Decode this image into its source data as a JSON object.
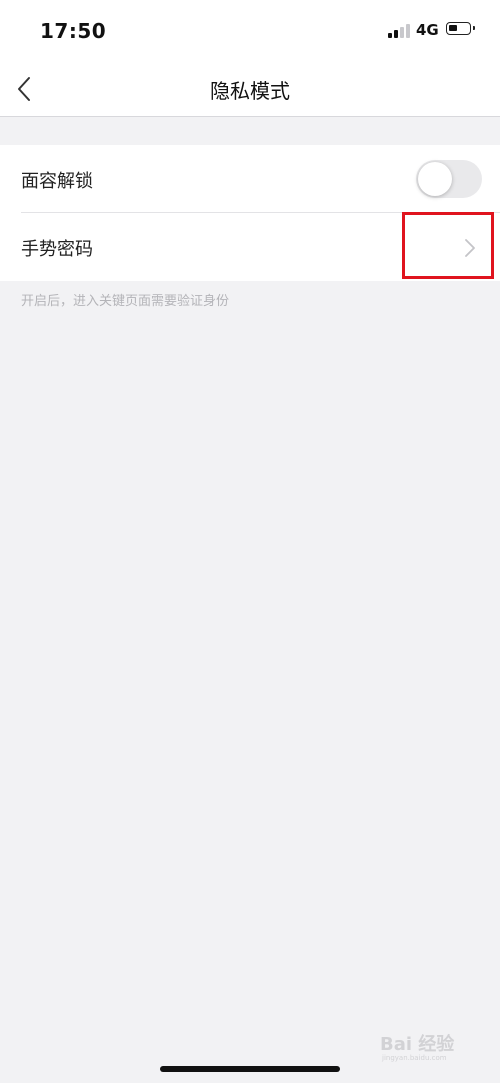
{
  "status_bar": {
    "time": "17:50",
    "network": "4G",
    "signal_bars_filled": 2,
    "signal_bars_total": 4,
    "battery_level": 0.45
  },
  "nav": {
    "title": "隐私模式",
    "back_icon": "chevron-left-icon"
  },
  "settings": {
    "face_unlock": {
      "label": "面容解锁",
      "enabled": false
    },
    "gesture_password": {
      "label": "手势密码",
      "icon": "chevron-right-icon"
    },
    "hint": "开启后，进入关键页面需要验证身份"
  },
  "colors": {
    "highlight_border": "#e0141e",
    "toggle_off": "#e9e9eb",
    "background": "#f2f2f4"
  },
  "watermark": {
    "text": "Bai 经验",
    "sub": "jingyan.baidu.com"
  }
}
